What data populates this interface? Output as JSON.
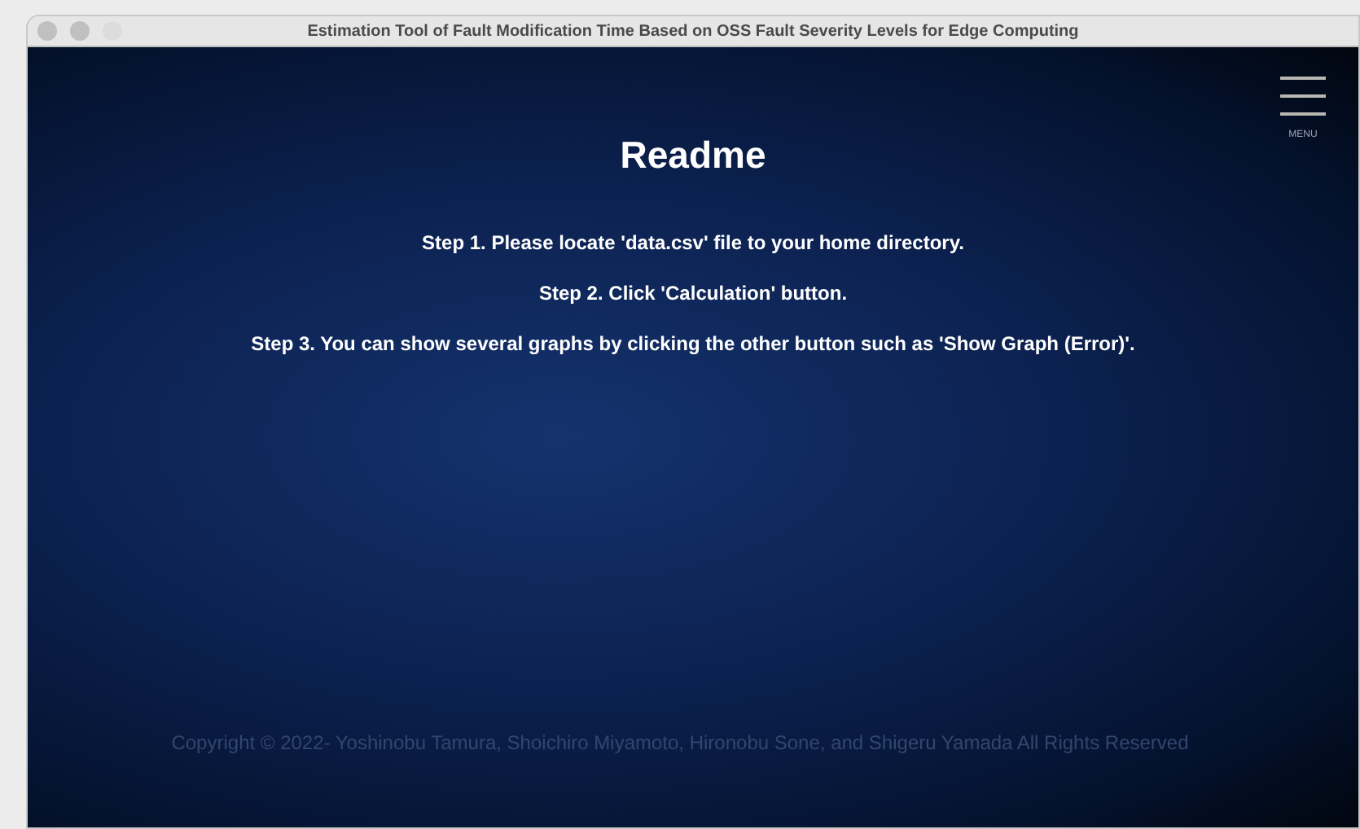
{
  "window": {
    "title": "Estimation Tool of Fault Modification Time Based on OSS Fault Severity Levels for Edge Computing"
  },
  "menu": {
    "label": "MENU"
  },
  "heading": "Readme",
  "steps": [
    "Step 1. Please locate 'data.csv' file to your home directory.",
    "Step 2. Click 'Calculation' button.",
    "Step 3. You can show several graphs by clicking the other button such as 'Show Graph (Error)'."
  ],
  "footer": {
    "copyright": "Copyright ©   2022- Yoshinobu Tamura, Shoichiro Miyamoto, Hironobu Sone, and Shigeru Yamada All Rights Reserved"
  }
}
